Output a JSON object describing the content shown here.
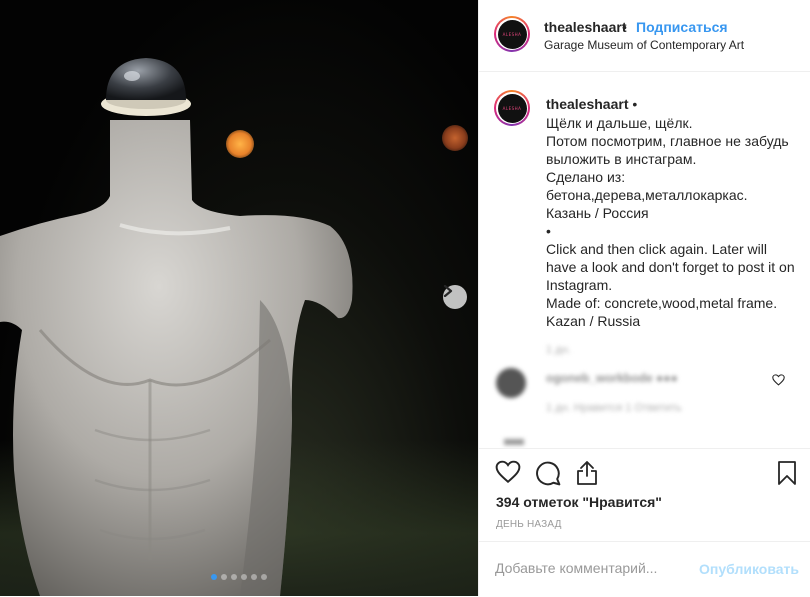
{
  "post": {
    "username": "thealeshaart",
    "separator": "•",
    "follow_label": "Подписаться",
    "location": "Garage Museum of Contemporary Art",
    "avatar_text": "ALESHA"
  },
  "caption": {
    "username": "thealeshaart",
    "separator": "•",
    "text": "Щёлк и дальше, щёлк.\nПотом посмотрим, главное не забудь выложить в инстаграм.\nСделано из:\nбетона,дерева,металлокаркас.\nКазань / Россия\n•\nClick and then click again. Later will have a look and don't forget to post it on Instagram.\nMade of: concrete,wood,metal frame.\nKazan / Russia"
  },
  "blurred_comment": {
    "time": "1 дн.",
    "name": "ogoneb_workbode ●●●",
    "meta": "1 дн.    Нравится 1    Ответить"
  },
  "actions": {
    "icons": [
      "heart-icon",
      "comment-icon",
      "share-icon",
      "bookmark-icon"
    ],
    "likes": "394 отметок \"Нравится\"",
    "time": "ДЕНЬ НАЗАД"
  },
  "comment_box": {
    "placeholder": "Добавьте комментарий...",
    "publish_label": "Опубликовать"
  },
  "carousel": {
    "slide_count": 6,
    "active_index": 0
  },
  "colors": {
    "accent": "#3897f0",
    "publish_disabled": "#b2dffc",
    "text": "#262626",
    "muted": "#999999"
  }
}
